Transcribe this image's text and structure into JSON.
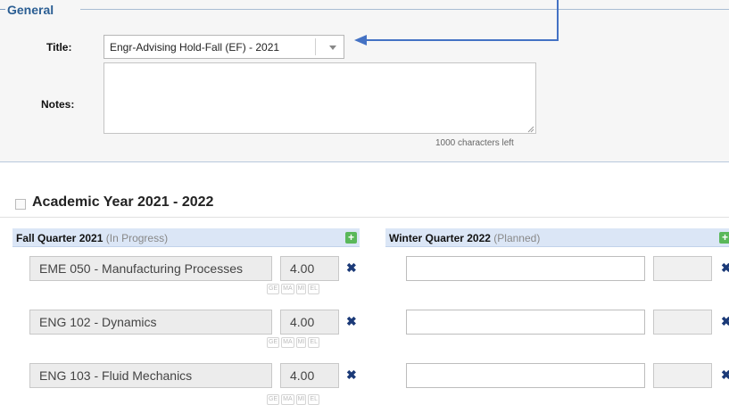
{
  "general": {
    "legend": "General",
    "title_label": "Title:",
    "title_value": "Engr-Advising Hold-Fall (EF) - 2021",
    "notes_label": "Notes:",
    "notes_value": "",
    "chars_left": "1000 characters left"
  },
  "academic_year": {
    "title": "Academic Year 2021 - 2022",
    "checked": false
  },
  "quarters": [
    {
      "name": "Fall Quarter 2021",
      "status": "(In Progress)",
      "courses": [
        {
          "course": "EME 050 - Manufacturing Processes",
          "units": "4.00",
          "tags": [
            "GE",
            "MA",
            "MI",
            "EL"
          ]
        },
        {
          "course": "ENG 102 - Dynamics",
          "units": "4.00",
          "tags": [
            "GE",
            "MA",
            "MI",
            "EL"
          ]
        },
        {
          "course": "ENG 103 - Fluid Mechanics",
          "units": "4.00",
          "tags": [
            "GE",
            "MA",
            "MI",
            "EL"
          ]
        }
      ]
    },
    {
      "name": "Winter Quarter 2022",
      "status": "(Planned)",
      "courses": [
        {
          "course": "",
          "units": ""
        },
        {
          "course": "",
          "units": ""
        },
        {
          "course": "",
          "units": ""
        }
      ]
    }
  ],
  "icons": {
    "add": "plus-icon",
    "remove": "close-icon",
    "dropdown": "chevron-down-icon"
  },
  "colors": {
    "accent": "#2b5e93",
    "header_bg": "#dbe6f6",
    "add_green": "#5ab85a",
    "remove_blue": "#1b3a78",
    "annotation_arrow": "#4472c4"
  }
}
